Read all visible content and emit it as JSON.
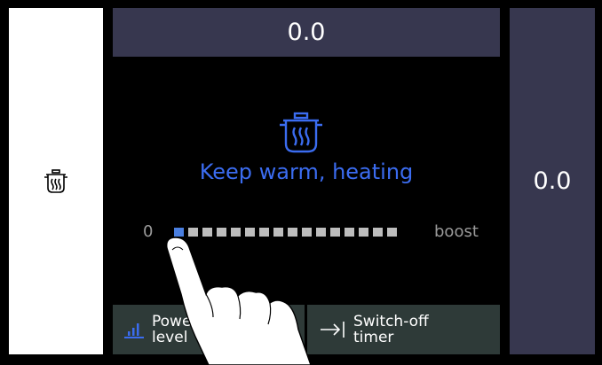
{
  "header": {
    "value": "0.0"
  },
  "right_panel": {
    "value": "0.0"
  },
  "left_panel": {
    "icon": "pot-icon"
  },
  "main": {
    "icon": "pot-steam-icon",
    "mode_label": "Keep warm, heating",
    "scale": {
      "min_label": "0",
      "max_label": "boost",
      "segment_count": 16,
      "active_segments": 1
    }
  },
  "buttons": {
    "power_level": {
      "label_line1": "Power",
      "label_line2": "level",
      "icon": "bar-chart-icon"
    },
    "switch_off_timer": {
      "label_line1": "Switch-off",
      "label_line2": "timer",
      "icon": "arrow-to-bar-icon"
    }
  },
  "colors": {
    "accent": "#3b6cf0",
    "panel": "#37374f",
    "button": "#2e3a38"
  }
}
